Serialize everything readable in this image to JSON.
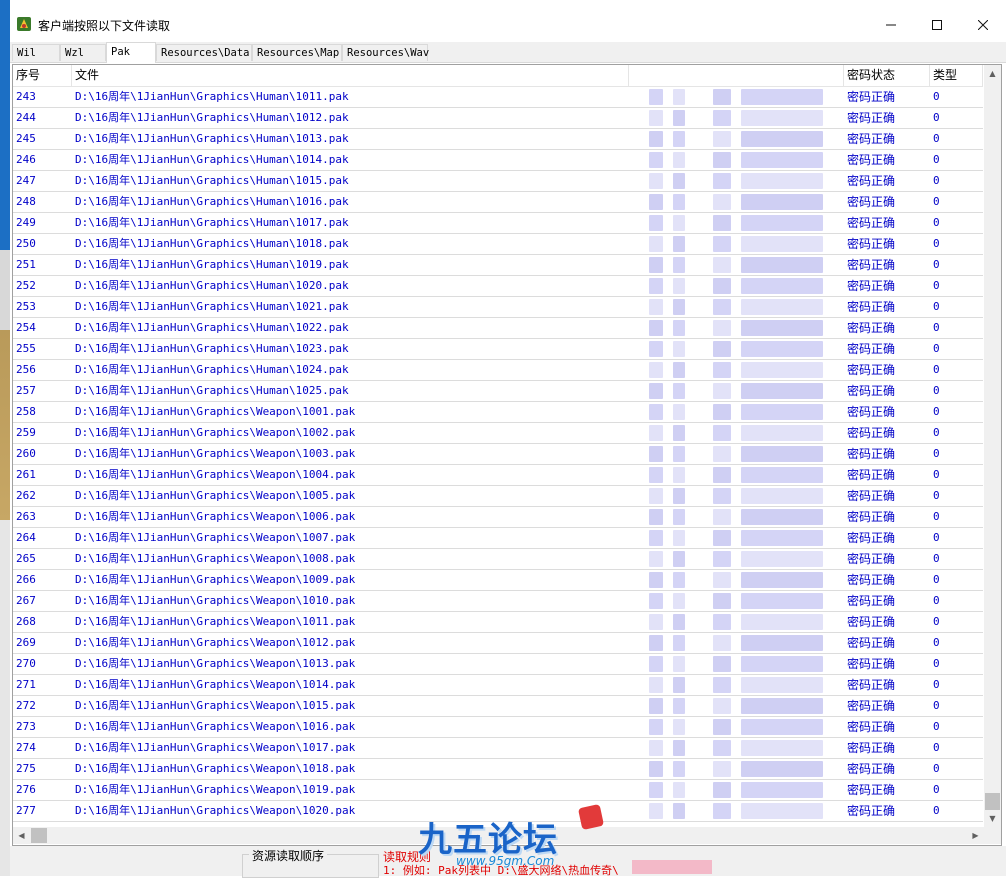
{
  "window": {
    "title": "客户端按照以下文件读取"
  },
  "tabs": [
    "Wil",
    "Wzl",
    "Pak",
    "Resources\\Data",
    "Resources\\Map",
    "Resources\\Wav"
  ],
  "active_tab": "Pak",
  "table": {
    "columns": [
      "序号",
      "文件",
      "",
      "密码状态",
      "类型"
    ],
    "rows": [
      {
        "no": "243",
        "file": "D:\\16周年\\1JianHun\\Graphics\\Human\\1011.pak",
        "status": "密码正确",
        "type": "0"
      },
      {
        "no": "244",
        "file": "D:\\16周年\\1JianHun\\Graphics\\Human\\1012.pak",
        "status": "密码正确",
        "type": "0"
      },
      {
        "no": "245",
        "file": "D:\\16周年\\1JianHun\\Graphics\\Human\\1013.pak",
        "status": "密码正确",
        "type": "0"
      },
      {
        "no": "246",
        "file": "D:\\16周年\\1JianHun\\Graphics\\Human\\1014.pak",
        "status": "密码正确",
        "type": "0"
      },
      {
        "no": "247",
        "file": "D:\\16周年\\1JianHun\\Graphics\\Human\\1015.pak",
        "status": "密码正确",
        "type": "0"
      },
      {
        "no": "248",
        "file": "D:\\16周年\\1JianHun\\Graphics\\Human\\1016.pak",
        "status": "密码正确",
        "type": "0"
      },
      {
        "no": "249",
        "file": "D:\\16周年\\1JianHun\\Graphics\\Human\\1017.pak",
        "status": "密码正确",
        "type": "0"
      },
      {
        "no": "250",
        "file": "D:\\16周年\\1JianHun\\Graphics\\Human\\1018.pak",
        "status": "密码正确",
        "type": "0"
      },
      {
        "no": "251",
        "file": "D:\\16周年\\1JianHun\\Graphics\\Human\\1019.pak",
        "status": "密码正确",
        "type": "0"
      },
      {
        "no": "252",
        "file": "D:\\16周年\\1JianHun\\Graphics\\Human\\1020.pak",
        "status": "密码正确",
        "type": "0"
      },
      {
        "no": "253",
        "file": "D:\\16周年\\1JianHun\\Graphics\\Human\\1021.pak",
        "status": "密码正确",
        "type": "0"
      },
      {
        "no": "254",
        "file": "D:\\16周年\\1JianHun\\Graphics\\Human\\1022.pak",
        "status": "密码正确",
        "type": "0"
      },
      {
        "no": "255",
        "file": "D:\\16周年\\1JianHun\\Graphics\\Human\\1023.pak",
        "status": "密码正确",
        "type": "0"
      },
      {
        "no": "256",
        "file": "D:\\16周年\\1JianHun\\Graphics\\Human\\1024.pak",
        "status": "密码正确",
        "type": "0"
      },
      {
        "no": "257",
        "file": "D:\\16周年\\1JianHun\\Graphics\\Human\\1025.pak",
        "status": "密码正确",
        "type": "0"
      },
      {
        "no": "258",
        "file": "D:\\16周年\\1JianHun\\Graphics\\Weapon\\1001.pak",
        "status": "密码正确",
        "type": "0"
      },
      {
        "no": "259",
        "file": "D:\\16周年\\1JianHun\\Graphics\\Weapon\\1002.pak",
        "status": "密码正确",
        "type": "0"
      },
      {
        "no": "260",
        "file": "D:\\16周年\\1JianHun\\Graphics\\Weapon\\1003.pak",
        "status": "密码正确",
        "type": "0"
      },
      {
        "no": "261",
        "file": "D:\\16周年\\1JianHun\\Graphics\\Weapon\\1004.pak",
        "status": "密码正确",
        "type": "0"
      },
      {
        "no": "262",
        "file": "D:\\16周年\\1JianHun\\Graphics\\Weapon\\1005.pak",
        "status": "密码正确",
        "type": "0"
      },
      {
        "no": "263",
        "file": "D:\\16周年\\1JianHun\\Graphics\\Weapon\\1006.pak",
        "status": "密码正确",
        "type": "0"
      },
      {
        "no": "264",
        "file": "D:\\16周年\\1JianHun\\Graphics\\Weapon\\1007.pak",
        "status": "密码正确",
        "type": "0"
      },
      {
        "no": "265",
        "file": "D:\\16周年\\1JianHun\\Graphics\\Weapon\\1008.pak",
        "status": "密码正确",
        "type": "0"
      },
      {
        "no": "266",
        "file": "D:\\16周年\\1JianHun\\Graphics\\Weapon\\1009.pak",
        "status": "密码正确",
        "type": "0"
      },
      {
        "no": "267",
        "file": "D:\\16周年\\1JianHun\\Graphics\\Weapon\\1010.pak",
        "status": "密码正确",
        "type": "0"
      },
      {
        "no": "268",
        "file": "D:\\16周年\\1JianHun\\Graphics\\Weapon\\1011.pak",
        "status": "密码正确",
        "type": "0"
      },
      {
        "no": "269",
        "file": "D:\\16周年\\1JianHun\\Graphics\\Weapon\\1012.pak",
        "status": "密码正确",
        "type": "0"
      },
      {
        "no": "270",
        "file": "D:\\16周年\\1JianHun\\Graphics\\Weapon\\1013.pak",
        "status": "密码正确",
        "type": "0"
      },
      {
        "no": "271",
        "file": "D:\\16周年\\1JianHun\\Graphics\\Weapon\\1014.pak",
        "status": "密码正确",
        "type": "0"
      },
      {
        "no": "272",
        "file": "D:\\16周年\\1JianHun\\Graphics\\Weapon\\1015.pak",
        "status": "密码正确",
        "type": "0"
      },
      {
        "no": "273",
        "file": "D:\\16周年\\1JianHun\\Graphics\\Weapon\\1016.pak",
        "status": "密码正确",
        "type": "0"
      },
      {
        "no": "274",
        "file": "D:\\16周年\\1JianHun\\Graphics\\Weapon\\1017.pak",
        "status": "密码正确",
        "type": "0"
      },
      {
        "no": "275",
        "file": "D:\\16周年\\1JianHun\\Graphics\\Weapon\\1018.pak",
        "status": "密码正确",
        "type": "0"
      },
      {
        "no": "276",
        "file": "D:\\16周年\\1JianHun\\Graphics\\Weapon\\1019.pak",
        "status": "密码正确",
        "type": "0"
      },
      {
        "no": "277",
        "file": "D:\\16周年\\1JianHun\\Graphics\\Weapon\\1020.pak",
        "status": "密码正确",
        "type": "0"
      }
    ]
  },
  "bottom": {
    "group_label": "资源读取顺序",
    "info_line1": "读取规则",
    "info_line2": "1: 例如: Pak列表中 D:\\盛大网络\\热血传奇\\"
  },
  "watermark": {
    "logo_text": "九五论坛",
    "url": "www.95gm.Com"
  },
  "colors": {
    "row_text": "#0000c8",
    "info_text": "#e00000",
    "blur": "#d8d8f4"
  },
  "icons": {
    "app": "app-icon",
    "minimize": "minimize-icon",
    "maximize": "maximize-icon",
    "close": "close-icon"
  }
}
